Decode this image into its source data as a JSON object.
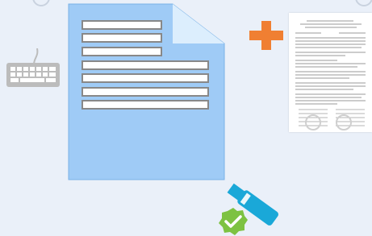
{
  "illustration": {
    "icons": [
      "keyboard-icon",
      "document-template-icon",
      "plus-icon",
      "signed-document-icon",
      "usb-token-icon",
      "checkmark-badge-icon"
    ]
  },
  "colors": {
    "background": "#eaf0f9",
    "document_fill": "#9fcbf6",
    "document_fold": "#dceefd",
    "field_border": "#888888",
    "plus": "#f07f32",
    "keyboard": "#bcbcbc",
    "token": "#1aa8d8",
    "check_badge": "#7dc242"
  }
}
